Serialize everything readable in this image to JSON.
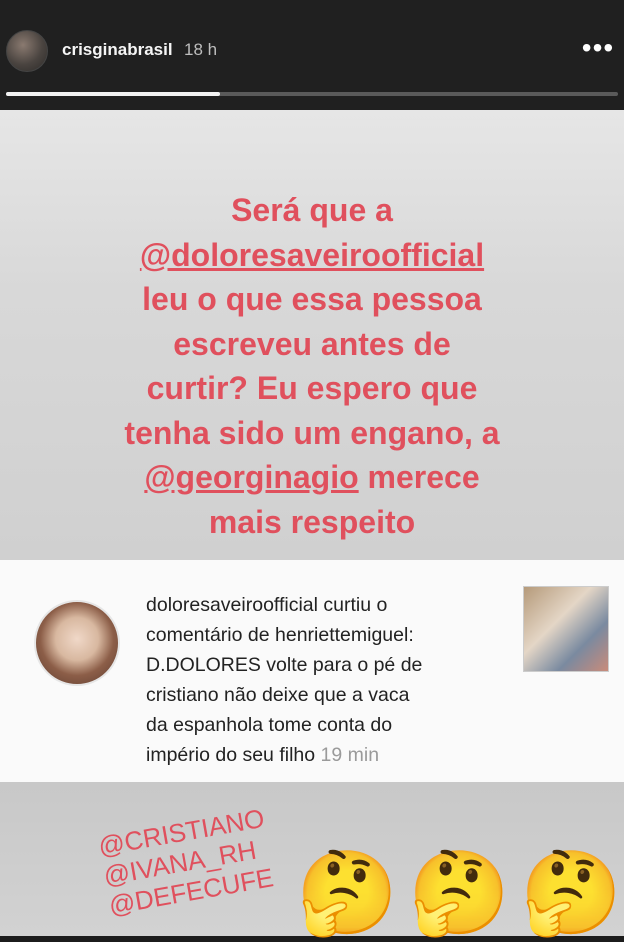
{
  "header": {
    "username": "crisginabrasil",
    "time": "18 h",
    "more_label": "•••",
    "progress": 0.35
  },
  "story": {
    "line1": "Será que a",
    "mention1": "@doloresaveiroofficial",
    "line2": "leu o que essa pessoa",
    "line3": "escreveu antes de",
    "line4": "curtir? Eu espero que",
    "line5": "tenha sido um engano, a",
    "mention2": "@georginagio",
    "line6_rest": " merece",
    "line7": "mais respeito"
  },
  "notification": {
    "user": "doloresaveiroofficial",
    "action1": " curtiu o",
    "action2": "comentário de ",
    "commenter": "henriettemiguel",
    "colon": ":",
    "comment_line1": "D.DOLORES volte para o pé de",
    "comment_line2": "cristiano não deixe que a vaca",
    "comment_line3": "da espanhola tome conta do",
    "comment_line4": "império do seu filho",
    "time": " 19 min"
  },
  "bottom": {
    "hashtag1": "@CRISTIANO",
    "hashtag2": "@IVANA_RH",
    "hashtag3": "@DEFECUFE",
    "emoji": "🤔"
  }
}
